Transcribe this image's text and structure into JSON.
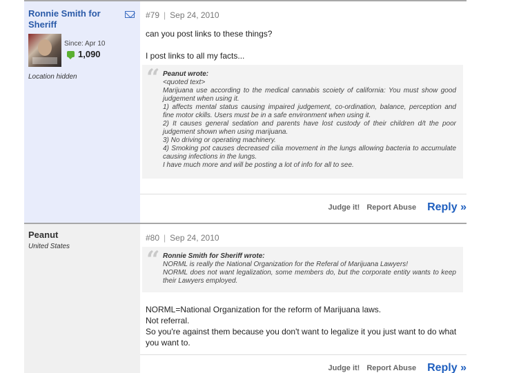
{
  "posts": [
    {
      "author": "Ronnie Smith for Sheriff",
      "since": "Since: Apr 10",
      "points": "1,090",
      "location": "Location hidden",
      "number": "#79",
      "date": "Sep 24, 2010",
      "lines_before": [
        "can you post links to these things?"
      ],
      "lines_mid": [
        "I post links to all my facts..."
      ],
      "quote": {
        "author": "Peanut wrote:",
        "lines": [
          "<quoted text>",
          "Marijuana use according to the medical cannabis scoiety of california: You must show good judgement when using it.",
          "1) affects mental status causing impaired judgement, co-ordination, balance, perception and fine motor ckills. Users must be in a safe environment when using it.",
          "2) It causes general sedation and parents have lost custody of their children d/t the poor judgement shown when using marijuana.",
          "3) No driving or operating machinery.",
          "4) Smoking pot causes decreased cilia movement in the lungs allowing bacteria to accumulate causing infections in the lungs.",
          "I have much more and will be posting a lot of info for all to see."
        ]
      },
      "actions": {
        "judge": "Judge it!",
        "report": "Report Abuse",
        "reply": "Reply »"
      }
    },
    {
      "author": "Peanut",
      "location": "United States",
      "number": "#80",
      "date": "Sep 24, 2010",
      "quote": {
        "author": "Ronnie Smith for Sheriff wrote:",
        "lines": [
          "NORML is really the National Organization for the Referal of Marijuana Lawyers!",
          "NORML does not want legalization, some members do, but the corporate entity wants to keep their Lawyers employed."
        ]
      },
      "lines_after": [
        "NORML=National Organization for the reform of Marijuana laws.",
        "Not referral.",
        "So you're against them because you don't want to legalize it you just want to do what you want to."
      ],
      "actions": {
        "judge": "Judge it!",
        "report": "Report Abuse",
        "reply": "Reply »"
      }
    }
  ],
  "icons": {
    "mail": "envelope-icon",
    "points": "speech-bubble-icon",
    "quote": "quote-mark-icon"
  },
  "colors": {
    "author_link": "#2a5aa8",
    "reply_link": "#1f5fbf",
    "sidebar_1": "#e8ecfb",
    "sidebar_2": "#f0f0f0",
    "points_icon": "#5ab031"
  }
}
